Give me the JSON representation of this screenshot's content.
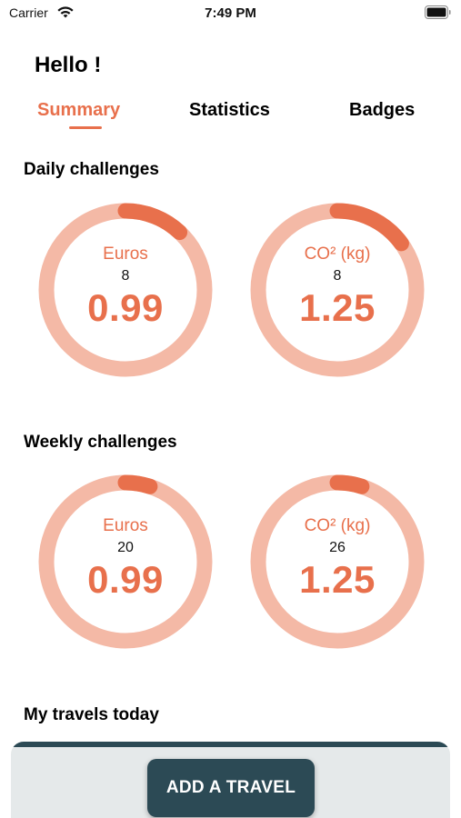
{
  "status_bar": {
    "carrier": "Carrier",
    "time": "7:49 PM",
    "wifi_icon": "wifi-icon",
    "battery_icon": "battery-icon"
  },
  "greeting": "Hello !",
  "tabs": [
    {
      "label": "Summary",
      "active": true
    },
    {
      "label": "Statistics",
      "active": false
    },
    {
      "label": "Badges",
      "active": false
    }
  ],
  "daily": {
    "title": "Daily challenges",
    "rings": [
      {
        "label": "Euros",
        "count": "8",
        "value": "0.99",
        "progress": 0.12
      },
      {
        "label": "CO² (kg)",
        "count": "8",
        "value": "1.25",
        "progress": 0.15
      }
    ]
  },
  "weekly": {
    "title": "Weekly challenges",
    "rings": [
      {
        "label": "Euros",
        "count": "20",
        "value": "0.99",
        "progress": 0.05
      },
      {
        "label": "CO² (kg)",
        "count": "26",
        "value": "1.25",
        "progress": 0.05
      }
    ]
  },
  "travels": {
    "title": "My travels today"
  },
  "add_button": "ADD A TRAVEL",
  "colors": {
    "accent": "#e8704c",
    "ring_track": "#f4b9a6",
    "ring_progress": "#e8704c",
    "dark": "#2c4a55"
  }
}
